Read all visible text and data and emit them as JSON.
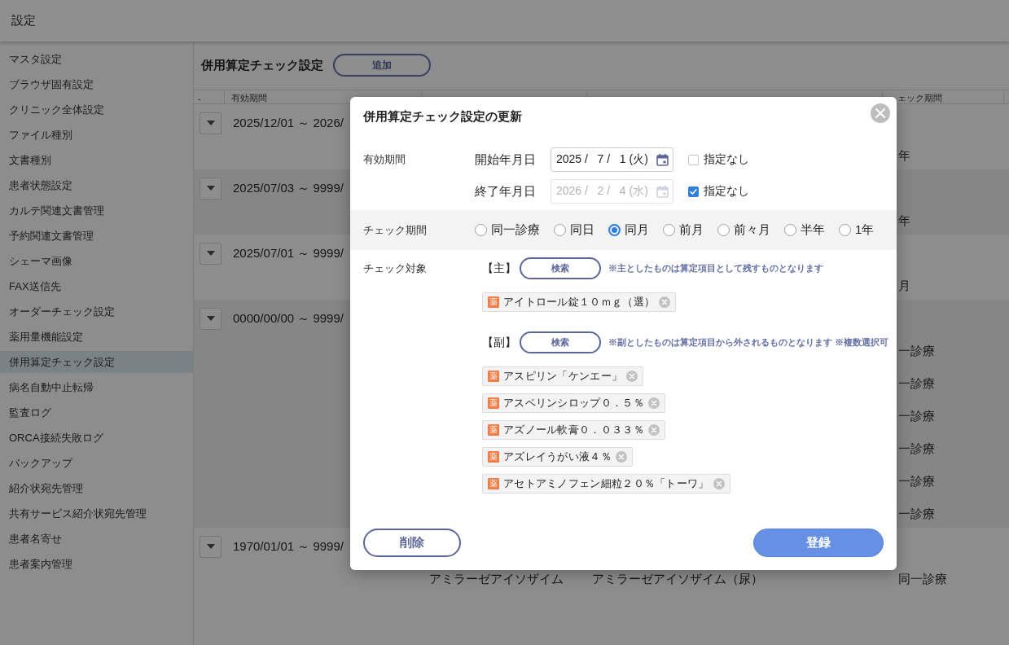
{
  "header": {
    "title": "設定"
  },
  "sidebar": {
    "items": [
      {
        "label": "マスタ設定",
        "selected": false
      },
      {
        "label": "ブラウザ固有設定",
        "selected": false
      },
      {
        "label": "クリニック全体設定",
        "selected": false
      },
      {
        "label": "ファイル種別",
        "selected": false
      },
      {
        "label": "文書種別",
        "selected": false
      },
      {
        "label": "患者状態設定",
        "selected": false
      },
      {
        "label": "カルテ関連文書管理",
        "selected": false
      },
      {
        "label": "予約関連文書管理",
        "selected": false
      },
      {
        "label": "シェーマ画像",
        "selected": false
      },
      {
        "label": "FAX送信先",
        "selected": false
      },
      {
        "label": "オーダーチェック設定",
        "selected": false
      },
      {
        "label": "薬用量機能設定",
        "selected": false
      },
      {
        "label": "併用算定チェック設定",
        "selected": true
      },
      {
        "label": "病名自動中止転帰",
        "selected": false
      },
      {
        "label": "監査ログ",
        "selected": false
      },
      {
        "label": "ORCA接続失敗ログ",
        "selected": false
      },
      {
        "label": "バックアップ",
        "selected": false
      },
      {
        "label": "紹介状宛先管理",
        "selected": false
      },
      {
        "label": "共有サービス紹介状宛先管理",
        "selected": false
      },
      {
        "label": "患者名寄せ",
        "selected": false
      },
      {
        "label": "患者案内管理",
        "selected": false
      }
    ]
  },
  "main": {
    "title": "併用算定チェック設定",
    "add_button": "追加",
    "table": {
      "header": {
        "column_1": "-",
        "column_2": "有効期間",
        "column_5": "ェック期間"
      },
      "groups": [
        {
          "period": "2025/12/01 ～ 2026/",
          "rows": [
            {
              "column_5": "年"
            }
          ]
        },
        {
          "period": "2025/07/03 ～ 9999/",
          "rows": [
            {
              "column_5": "年"
            }
          ]
        },
        {
          "period": "2025/07/01 ～ 9999/",
          "rows": [
            {
              "column_5": "月"
            }
          ]
        },
        {
          "period": "0000/00/00 ～ 9999/",
          "rows": [
            {
              "column_5": "一診療"
            },
            {
              "column_5": "一診療"
            },
            {
              "column_5": "一診療"
            },
            {
              "column_5": "一診療"
            },
            {
              "column_5": "一診療"
            },
            {
              "column_5": "一診療"
            }
          ]
        },
        {
          "period": "1970/01/01 ～ 9999/",
          "rows": [
            {
              "column_3": "アミラーゼアイソザイム",
              "column_4": "アミラーゼアイソザイム（尿）",
              "column_5": "同一診療"
            }
          ]
        }
      ]
    }
  },
  "dialog": {
    "title": "併用算定チェック設定の更新",
    "validity": {
      "label": "有効期間",
      "fields": [
        {
          "label": "開始年月日",
          "value": "2025 /   7 /   1 (火)",
          "disabled": false,
          "checkbox": {
            "label": "指定なし",
            "checked": false
          }
        },
        {
          "label": "終了年月日",
          "value": "2026 /   2 /   4 (水)",
          "disabled": true,
          "checkbox": {
            "label": "指定なし",
            "checked": true
          }
        }
      ]
    },
    "check_period": {
      "label": "チェック期間",
      "options": [
        {
          "label": "同一診療",
          "selected": false
        },
        {
          "label": "同日",
          "selected": false
        },
        {
          "label": "同月",
          "selected": true
        },
        {
          "label": "前月",
          "selected": false
        },
        {
          "label": "前々月",
          "selected": false
        },
        {
          "label": "半年",
          "selected": false
        },
        {
          "label": "1年",
          "selected": false
        }
      ]
    },
    "targets": {
      "label": "チェック対象",
      "groups": [
        {
          "heading": "【主】",
          "search_button": "検索",
          "note": "※主としたものは算定項目として残すものとなります",
          "items": [
            {
              "tag": "薬",
              "name": "アイトロール錠１０ｍｇ（選）"
            }
          ]
        },
        {
          "heading": "【副】",
          "search_button": "検索",
          "note": "※副としたものは算定項目から外されるものとなります ※複数選択可",
          "items": [
            {
              "tag": "薬",
              "name": "アスピリン「ケンエー」"
            },
            {
              "tag": "薬",
              "name": "アスベリンシロップ０．５％"
            },
            {
              "tag": "薬",
              "name": "アズノール軟膏０．０３３％"
            },
            {
              "tag": "薬",
              "name": "アズレイうがい液４％"
            },
            {
              "tag": "薬",
              "name": "アセトアミノフェン細粒２０％「トーワ」"
            }
          ]
        }
      ]
    },
    "buttons": [
      {
        "kind": "secondary",
        "label": "削除"
      },
      {
        "kind": "primary",
        "label": "登録"
      }
    ]
  }
}
